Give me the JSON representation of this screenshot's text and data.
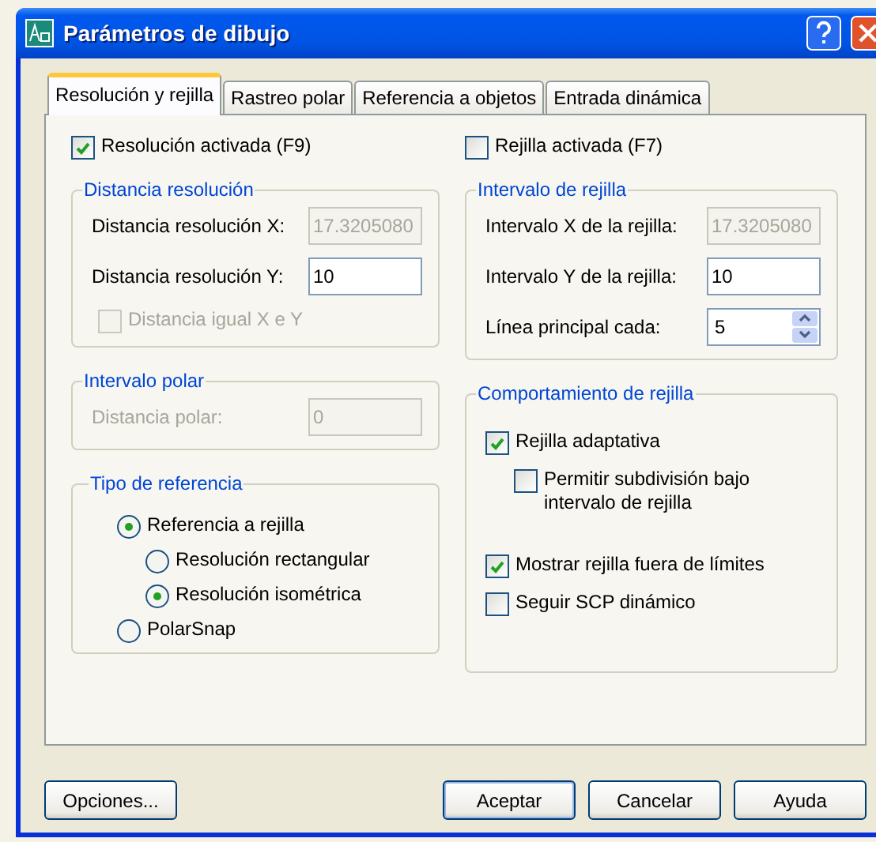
{
  "window": {
    "title": "Parámetros de dibujo"
  },
  "tabs": [
    {
      "label": "Resolución y rejilla",
      "selected": true
    },
    {
      "label": "Rastreo polar",
      "selected": false
    },
    {
      "label": "Referencia a objetos",
      "selected": false
    },
    {
      "label": "Entrada dinámica",
      "selected": false
    }
  ],
  "snap": {
    "checkbox": {
      "label": "Resolución activada (F9)",
      "checked": true,
      "disabled": false
    },
    "spacing_group": {
      "title": "Distancia resolución",
      "fields": [
        {
          "label": "Distancia resolución X:",
          "label_disabled": false,
          "value": "17.3205080",
          "disabled": true
        },
        {
          "label": "Distancia resolución Y:",
          "label_disabled": false,
          "value": "10",
          "disabled": false
        }
      ],
      "checkbox": {
        "label": "Distancia igual X e Y",
        "checked": false,
        "disabled": true
      }
    },
    "polar_group": {
      "title": "Intervalo polar",
      "field": {
        "label": "Distancia polar:",
        "label_disabled": true,
        "value": "0",
        "disabled": true
      }
    },
    "type_group": {
      "title": "Tipo de referencia",
      "options": [
        {
          "label": "Referencia a rejilla",
          "selected": true,
          "children": [
            {
              "label": "Resolución rectangular",
              "selected": false
            },
            {
              "label": "Resolución isométrica",
              "selected": true
            }
          ]
        },
        {
          "label": "PolarSnap",
          "selected": false
        }
      ]
    }
  },
  "grid": {
    "checkbox": {
      "label": "Rejilla activada (F7)",
      "checked": false,
      "disabled": false
    },
    "spacing_group": {
      "title": "Intervalo de rejilla",
      "fields": [
        {
          "label": "Intervalo X de la rejilla:",
          "label_disabled": false,
          "value": "17.3205080",
          "disabled": true,
          "kind": "text"
        },
        {
          "label": "Intervalo Y de la rejilla:",
          "label_disabled": false,
          "value": "10",
          "disabled": false,
          "kind": "text"
        },
        {
          "label": "Línea principal cada:",
          "label_disabled": false,
          "value": "5",
          "disabled": false,
          "kind": "spinner"
        }
      ]
    },
    "behavior_group": {
      "title": "Comportamiento de rejilla",
      "options": [
        {
          "label": "Rejilla adaptativa",
          "checked": true,
          "children": [
            {
              "label": "Permitir subdivisión bajo intervalo de rejilla",
              "checked": false
            }
          ]
        },
        {
          "label": "Mostrar rejilla fuera de límites",
          "checked": true
        },
        {
          "label": "Seguir SCP dinámico",
          "checked": false
        }
      ]
    }
  },
  "options_button": {
    "label": "Opciones...",
    "default": false
  },
  "buttons": [
    {
      "label": "Aceptar",
      "default": true
    },
    {
      "label": "Cancelar",
      "default": false
    },
    {
      "label": "Ayuda",
      "default": false
    }
  ]
}
